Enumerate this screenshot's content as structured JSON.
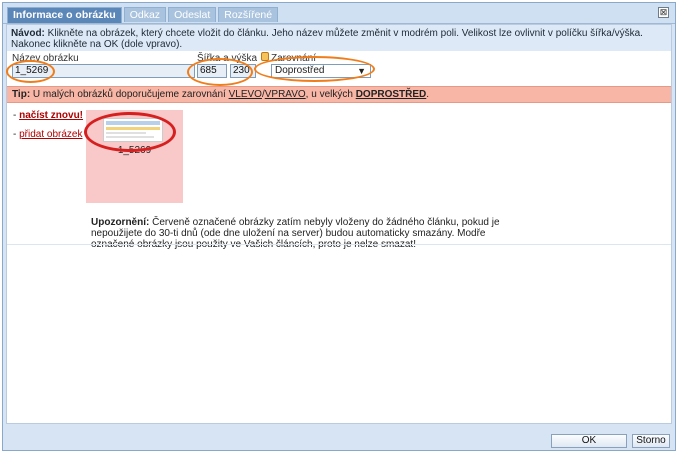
{
  "tabs": [
    {
      "label": "Informace o obrázku",
      "active": true
    },
    {
      "label": "Odkaz",
      "active": false
    },
    {
      "label": "Odeslat",
      "active": false
    },
    {
      "label": "Rozšířené",
      "active": false
    }
  ],
  "close_glyph": "⊠",
  "instructions": {
    "bold": "Návod:",
    "line1": " Klikněte na obrázek, který chcete vložit do článku. Jeho název můžete změnit v modrém poli. Velikost lze ovlivnit v políčku šířka/výška.",
    "line2": "Nakonec klikněte na OK (dole vpravo)."
  },
  "fields": {
    "name_label": "Název obrázku",
    "name_value": "1_5269",
    "size_label": "Šířka a výška",
    "width_value": "685",
    "height_value": "230",
    "align_label": "Zarovnání",
    "align_value": "Doprostřed",
    "align_arrow": "▼"
  },
  "tip": {
    "bold": "Tip:",
    "text": " U malých obrázků doporučujeme zarovnání ",
    "left": "VLEVO",
    "slash": "/",
    "right": "VPRAVO",
    "mid": ", u velkých ",
    "center": "DOPROSTŘED",
    "end": "."
  },
  "sidebar": {
    "reload_prefix": "- ",
    "reload": "načíst znovu!",
    "add_prefix": "- ",
    "add": "přidat obrázek"
  },
  "image_tile": {
    "label": "1_5269"
  },
  "warning": {
    "bold": "Upozornění:",
    "text": " Červeně označené obrázky zatím nebyly vloženy do žádného článku, pokud je nepoužijete do 30-ti dnů (ode dne uložení na server) budou automaticky smazány. Modře označené obrázky jsou použity ve Vašich článcích, proto je nelze smazat!"
  },
  "buttons": {
    "ok": "OK",
    "cancel": "Storno"
  },
  "colors": {
    "annotation": "#f07d1a",
    "annotation_red": "#d62020",
    "unused_image": "#f9c8c8"
  }
}
